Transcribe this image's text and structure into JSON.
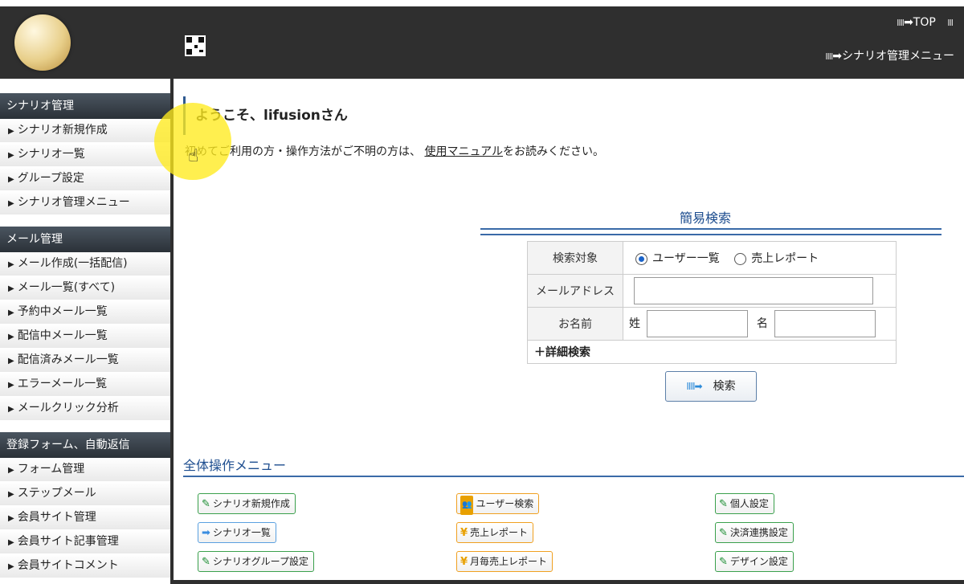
{
  "header": {
    "top_link": "TOP",
    "top_link_bars": "IIII",
    "menu_link": "シナリオ管理メニュー",
    "menu_link_bars": "IIII",
    "right_clip_bars": "III"
  },
  "sidebar": {
    "sections": [
      {
        "title": "シナリオ管理",
        "items": [
          "シナリオ新規作成",
          "シナリオ一覧",
          "グループ設定",
          "シナリオ管理メニュー"
        ]
      },
      {
        "title": "メール管理",
        "items": [
          "メール作成(一括配信)",
          "メール一覧(すべて)",
          "予約中メール一覧",
          "配信中メール一覧",
          "配信済みメール一覧",
          "エラーメール一覧",
          "メールクリック分析"
        ]
      },
      {
        "title": "登録フォーム、自動返信",
        "items": [
          "フォーム管理",
          "ステップメール",
          "会員サイト管理",
          "会員サイト記事管理",
          "会員サイトコメント"
        ]
      }
    ],
    "bullet": "▶"
  },
  "main": {
    "welcome": "ようこそ、lifusionさん",
    "intro_prefix": "初めてご利用の方・操作方法がご不明の方は、",
    "intro_link": "使用マニュアル",
    "intro_suffix": "をお読みください。"
  },
  "search": {
    "title": "簡易検索",
    "target_label": "検索対象",
    "option_users": "ユーザー一覧",
    "option_sales": "売上レポート",
    "email_label": "メールアドレス",
    "name_label": "お名前",
    "last_name_label": "姓",
    "first_name_label": "名",
    "advanced": "＋詳細検索",
    "button_label": "検索",
    "button_arrow": "IIII➡"
  },
  "menu": {
    "title": "全体操作メニュー",
    "buttons": [
      {
        "label": "シナリオ新規作成",
        "icon": "pencil-icon",
        "glyph": "✎"
      },
      {
        "label": "ユーザー検索",
        "icon": "user-icon",
        "glyph": "👥"
      },
      {
        "label": "個人設定",
        "icon": "pencil-icon",
        "glyph": "✎"
      },
      {
        "label": "シナリオ一覧",
        "icon": "arrow-icon",
        "glyph": "➡"
      },
      {
        "label": "売上レポート",
        "icon": "yen-icon",
        "glyph": "¥"
      },
      {
        "label": "決済連携設定",
        "icon": "pencil-icon",
        "glyph": "✎"
      },
      {
        "label": "シナリオグループ設定",
        "icon": "pencil-icon",
        "glyph": "✎"
      },
      {
        "label": "月毎売上レポート",
        "icon": "yen-icon",
        "glyph": "¥"
      },
      {
        "label": "デザイン設定",
        "icon": "pencil-icon",
        "glyph": "✎"
      }
    ]
  },
  "colors": {
    "header_bg": "#2f2f2f",
    "accent_blue": "#1d4d8f",
    "green_border": "#3aa04c",
    "orange_border": "#f0a020",
    "blue_border": "#5aa0e0",
    "cursor_highlight": "#ffeb1e"
  }
}
